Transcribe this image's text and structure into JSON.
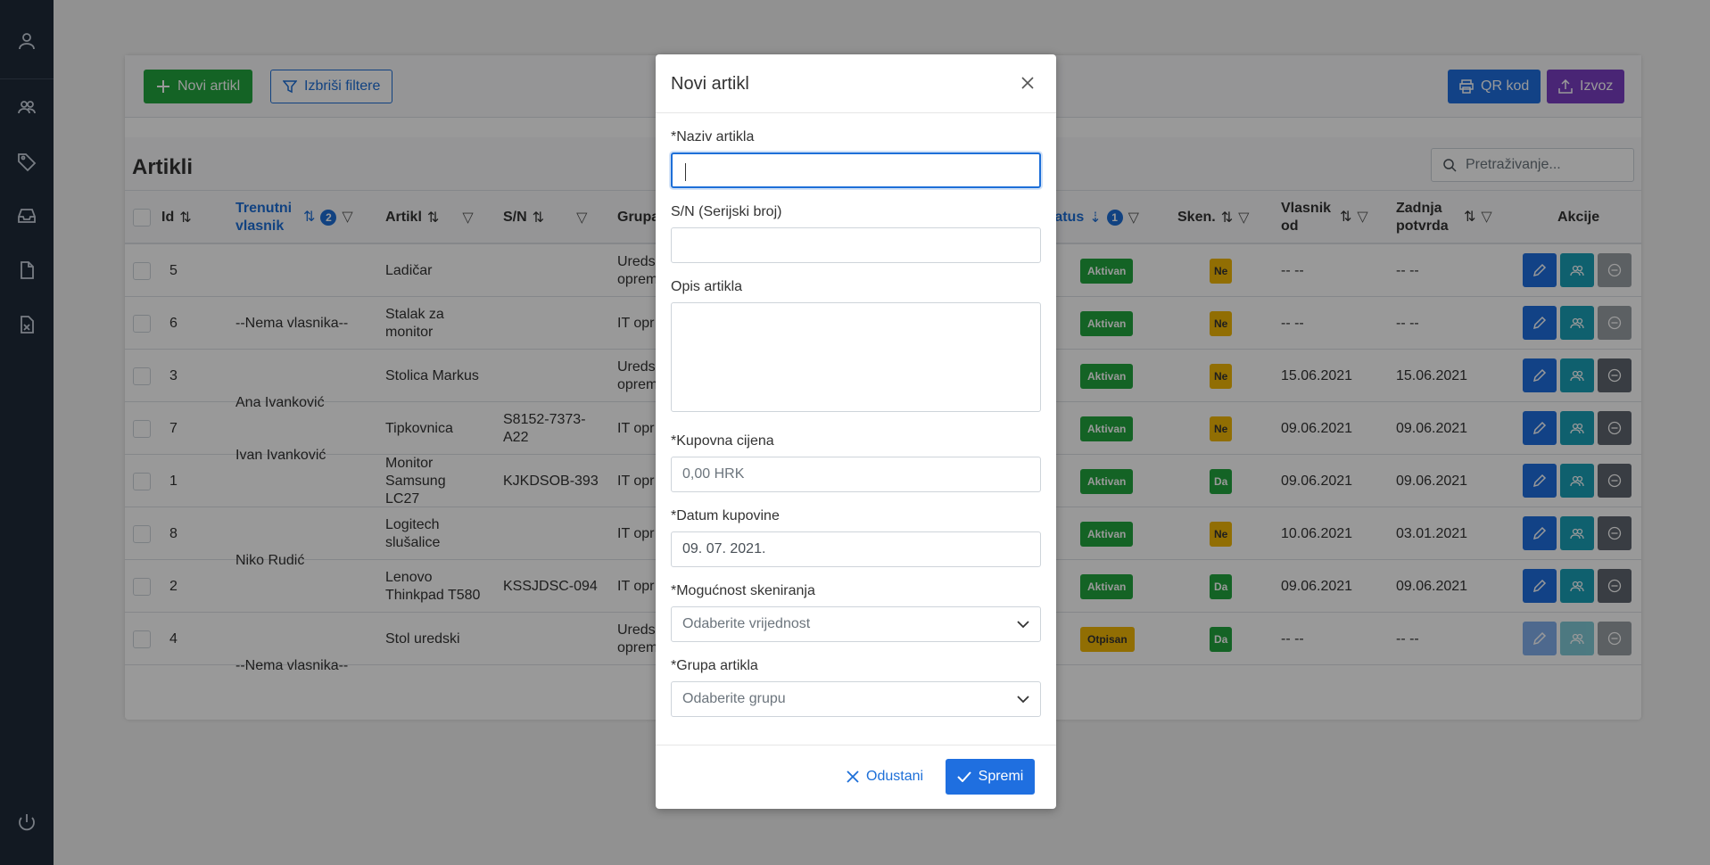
{
  "sidebar": {
    "icons": [
      "user-icon",
      "users-icon",
      "tag-icon",
      "inbox-icon",
      "document-icon",
      "spreadsheet-icon",
      "power-icon"
    ]
  },
  "toolbar": {
    "new_item": "Novi artikl",
    "clear_filters": "Izbriši filtere",
    "qr_code": "QR kod",
    "export": "Izvoz"
  },
  "page": {
    "title": "Artikli",
    "search_placeholder": "Pretraživanje..."
  },
  "columns": {
    "id": "Id",
    "owner": "Trenutni vlasnik",
    "owner_filter_count": "2",
    "item": "Artikl",
    "sn": "S/N",
    "group": "Grupa",
    "status": "tatus",
    "status_filter_count": "1",
    "scan": "Sken.",
    "owner_since": "Vlasnik od",
    "last_confirm": "Zadnja potvrda",
    "actions": "Akcije"
  },
  "rows": [
    {
      "id": "5",
      "item": "Ladičar",
      "sn": "",
      "group": "Uredsk opremo",
      "status": "Aktivan",
      "scan": "Ne",
      "since": "-- --",
      "confirm": "-- --"
    },
    {
      "id": "6",
      "item": "Stalak za monitor",
      "sn": "",
      "group": "IT opr",
      "status": "Aktivan",
      "scan": "Ne",
      "since": "-- --",
      "confirm": "-- --"
    },
    {
      "id": "3",
      "item": "Stolica Markus",
      "sn": "",
      "group": "Uredsk opremo",
      "status": "Aktivan",
      "scan": "Ne",
      "since": "15.06.2021",
      "confirm": "15.06.2021"
    },
    {
      "id": "7",
      "item": "Tipkovnica",
      "sn": "S8152-7373-A22",
      "group": "IT opr",
      "status": "Aktivan",
      "scan": "Ne",
      "since": "09.06.2021",
      "confirm": "09.06.2021"
    },
    {
      "id": "1",
      "item": "Monitor Samsung LC27",
      "sn": "KJKDSOB-393",
      "group": "IT opr",
      "status": "Aktivan",
      "scan": "Da",
      "since": "09.06.2021",
      "confirm": "09.06.2021"
    },
    {
      "id": "8",
      "item": "Logitech slušalice",
      "sn": "",
      "group": "IT opr",
      "status": "Aktivan",
      "scan": "Ne",
      "since": "10.06.2021",
      "confirm": "03.01.2021"
    },
    {
      "id": "2",
      "item": "Lenovo Thinkpad T580",
      "sn": "KSSJDSC-094",
      "group": "IT opr",
      "status": "Aktivan",
      "scan": "Da",
      "since": "09.06.2021",
      "confirm": "09.06.2021"
    },
    {
      "id": "4",
      "item": "Stol uredski",
      "sn": "",
      "group": "Uredsk opremo",
      "status": "Otpisan",
      "scan": "Da",
      "since": "-- --",
      "confirm": "-- --"
    }
  ],
  "owner_groups": [
    {
      "name": "--Nema vlasnika--"
    },
    {
      "name": "Ana Ivanković"
    },
    {
      "name": "Ivan Ivanković"
    },
    {
      "name": "Niko Rudić"
    },
    {
      "name": "--Nema vlasnika--"
    }
  ],
  "modal": {
    "title": "Novi artikl",
    "name_label": "*Naziv artikla",
    "name_value": "",
    "sn_label": "S/N (Serijski broj)",
    "sn_value": "",
    "desc_label": "Opis artikla",
    "price_label": "*Kupovna cijena",
    "price_placeholder": "0,00 HRK",
    "date_label": "*Datum kupovine",
    "date_value": "09. 07. 2021.",
    "scan_label": "*Mogućnost skeniranja",
    "scan_placeholder": "Odaberite vrijednost",
    "group_label": "*Grupa artikla",
    "group_placeholder": "Odaberite grupu",
    "cancel": "Odustani",
    "save": "Spremi"
  },
  "colors": {
    "sidebar": "#1e2a3a",
    "primary": "#1f6fe0",
    "success": "#22a63e",
    "warning": "#f2b705",
    "purple": "#7a3fc4",
    "teal": "#1aa0b8"
  }
}
